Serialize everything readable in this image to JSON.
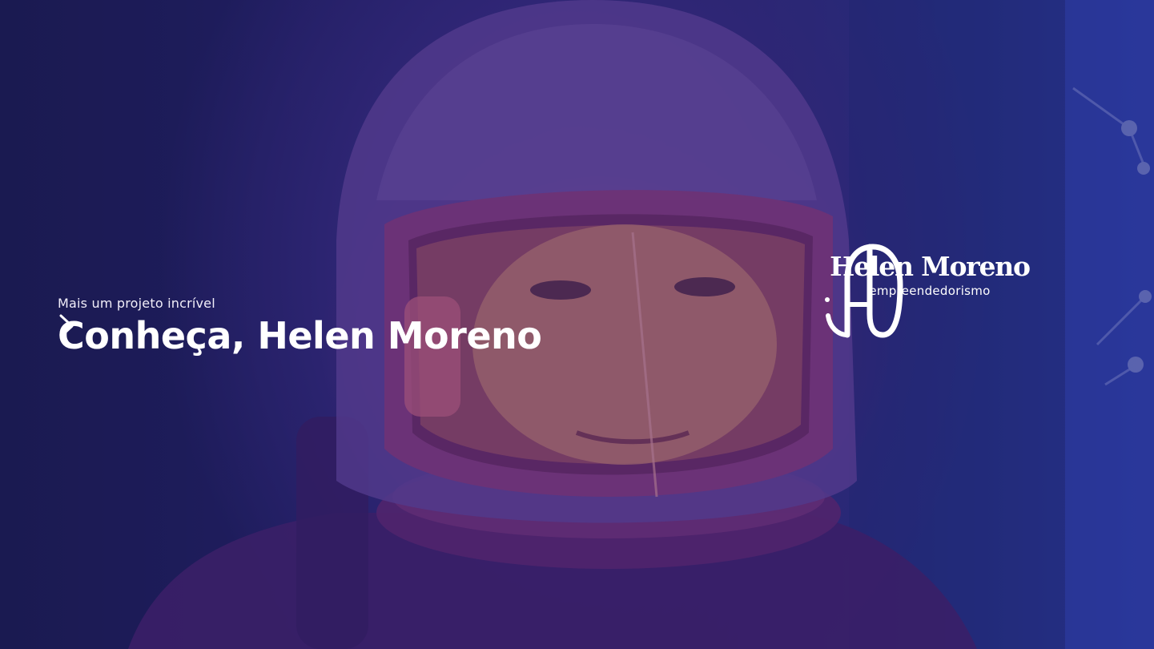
{
  "hero": {
    "intro": "Mais um projeto incrível",
    "cta_title": "Conheça, Helen Moreno",
    "background_photo": "astronaut-helmet-photo"
  },
  "brand": {
    "name": "Helen Moreno",
    "tagline": "empreendedorismo",
    "logo_icon": "monogram-h-icon"
  },
  "icons": {
    "cta": "chevron-right-icon"
  },
  "colors": {
    "overlay_deep": "#1d1a55",
    "overlay_blue": "#2f47b8",
    "glow_pink": "#e2547e",
    "text": "#ffffff"
  }
}
